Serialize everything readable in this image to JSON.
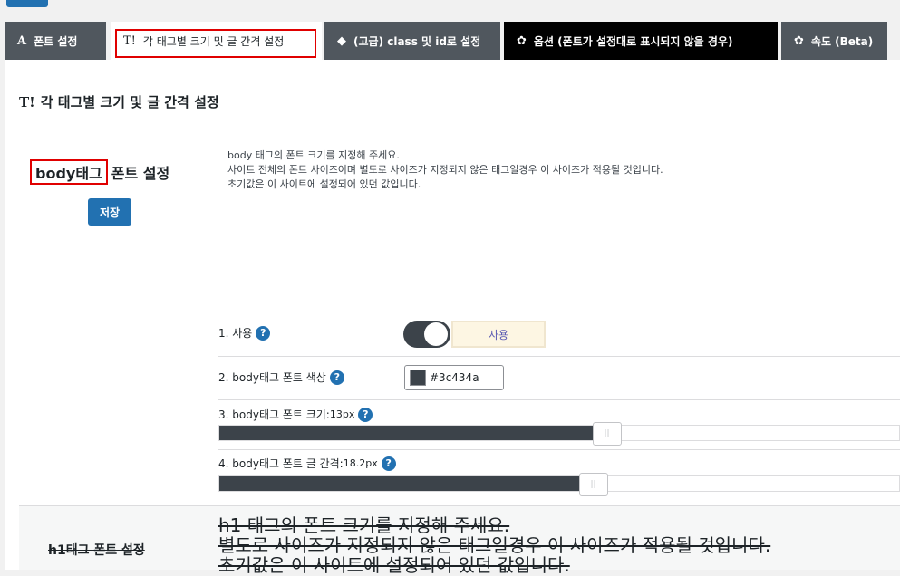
{
  "tabs": [
    {
      "icon": "A",
      "label": "폰트 설정"
    },
    {
      "icon": "T!",
      "label": "각 태그별 크기 및 글 간격 설정"
    },
    {
      "icon": "◆",
      "label": "(고급) class 및 id로 설정"
    },
    {
      "icon": "✿",
      "label": "옵션 (폰트가 설정대로 표시되지 않을 경우)"
    },
    {
      "icon": "✿",
      "label": "속도 (Beta)"
    }
  ],
  "section": {
    "icon": "T!",
    "title": "각 태그별 크기 및 글 간격 설정"
  },
  "body_tag": {
    "label_boxed": "body태그",
    "label_rest": "폰트 설정",
    "save_label": "저장",
    "description": [
      "body 태그의 폰트 크기를 지정해 주세요.",
      "사이트 전체의 폰트 사이즈이며 별도로 사이즈가 지정되지 않은 태그일경우 이 사이즈가 적용될 것입니다.",
      "초기값은 이 사이트에 설정되어 있던 값입니다."
    ],
    "rows": {
      "use": {
        "label": "1. 사용",
        "value_label": "사용",
        "enabled": true
      },
      "color": {
        "label": "2. body태그 폰트 색상",
        "value": "#3c434a"
      },
      "size": {
        "label": "3. body태그 폰트 크기:",
        "value": "13px",
        "fraction": 0.57
      },
      "spacing": {
        "label": "4. body태그 폰트 글 간격:",
        "value": "18.2px",
        "fraction": 0.55
      }
    }
  },
  "h1_tag": {
    "label": "h1태그 폰트 설정",
    "description": [
      "h1 태그의 폰트 크기를 지정해 주세요.",
      "별도로 사이즈가 지정되지 않은 태그일경우 이 사이즈가 적용될 것입니다.",
      "초기값은 이 사이트에 설정되어 있던 값입니다."
    ]
  },
  "colors": {
    "accent": "#2271b1",
    "dark": "#3c434a",
    "highlight": "#e00000"
  }
}
